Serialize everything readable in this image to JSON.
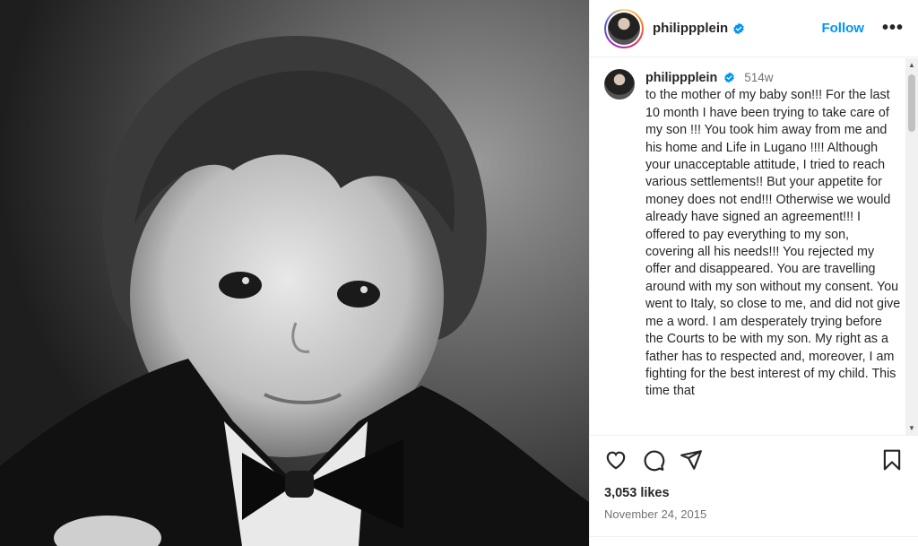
{
  "post": {
    "username": "philippplein",
    "follow_label": "Follow",
    "more_label": "•••",
    "caption": {
      "time": "514w",
      "text": "to the mother of my baby son!!! For the last 10 month I have been trying to take care of my son !!! You took him away from me and his home and Life in Lugano !!!! Although your unacceptable attitude, I tried to reach various settlements!! But your appetite for money does not end!!! Otherwise we would already have signed an agreement!!! I offered to pay everything to my son,  covering all his needs!!! You rejected my offer and disappeared. You are travelling around with my son without my consent. You went to Italy, so close to me, and did not give me a word. I am desperately trying before the Courts to be with my son. My right as a father has to respected and, moreover, I am fighting for the best interest of my child. This time that"
    },
    "likes": "3,053 likes",
    "date": "November 24, 2015"
  },
  "colors": {
    "accent": "#0095f6",
    "text": "#262626",
    "muted": "#737373"
  },
  "icons": [
    "heart-icon",
    "comment-icon",
    "share-icon",
    "bookmark-icon",
    "verified-badge-icon",
    "more-icon"
  ]
}
